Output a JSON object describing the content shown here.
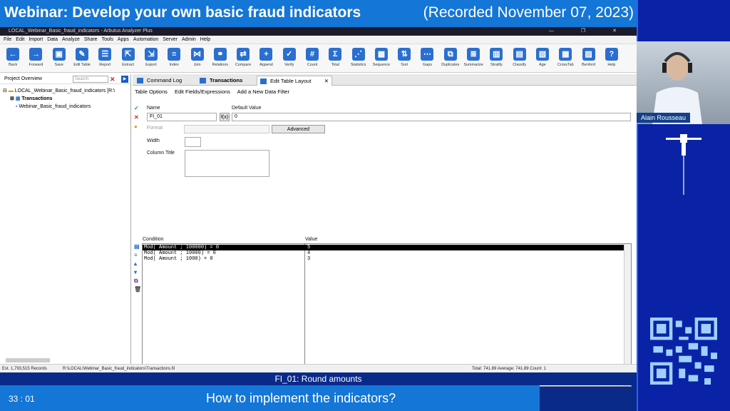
{
  "banner": {
    "title": "Webinar: Develop your own basic fraud indicators",
    "recorded": "(Recorded November 07, 2023)"
  },
  "presenter": {
    "name": "Alain Rousseau"
  },
  "window": {
    "title": "LOCAL_Webinar_Basic_fraud_indicators - Arbutus Analyzer Plus",
    "controls": "— ❐ ✕"
  },
  "menu": [
    "File",
    "Edit",
    "Import",
    "Data",
    "Analyze",
    "Share",
    "Tools",
    "Apps",
    "Automation",
    "Server",
    "Admin",
    "Help"
  ],
  "toolbar": [
    {
      "label": "Back",
      "icon": "back-arrow-icon",
      "glyph": "←"
    },
    {
      "label": "Forward",
      "icon": "forward-arrow-icon",
      "glyph": "→"
    },
    {
      "label": "Save",
      "icon": "save-icon",
      "glyph": "▣"
    },
    {
      "label": "Edit Table",
      "icon": "edit-table-icon",
      "glyph": "✎"
    },
    {
      "label": "Report",
      "icon": "report-icon",
      "glyph": "☰"
    },
    {
      "label": "Extract",
      "icon": "extract-icon",
      "glyph": "⇱"
    },
    {
      "label": "Export",
      "icon": "export-icon",
      "glyph": "⇲"
    },
    {
      "label": "Index",
      "icon": "index-icon",
      "glyph": "≡"
    },
    {
      "label": "Join",
      "icon": "join-icon",
      "glyph": "⋈"
    },
    {
      "label": "Relations",
      "icon": "relations-icon",
      "glyph": "⚭"
    },
    {
      "label": "Compare",
      "icon": "compare-icon",
      "glyph": "⇄"
    },
    {
      "label": "Append",
      "icon": "append-icon",
      "glyph": "+"
    },
    {
      "label": "Verify",
      "icon": "verify-icon",
      "glyph": "✓"
    },
    {
      "label": "Count",
      "icon": "count-icon",
      "glyph": "#"
    },
    {
      "label": "Total",
      "icon": "total-icon",
      "glyph": "Σ"
    },
    {
      "label": "Statistics",
      "icon": "statistics-icon",
      "glyph": "⋰"
    },
    {
      "label": "Sequence",
      "icon": "sequence-icon",
      "glyph": "▦"
    },
    {
      "label": "Sort",
      "icon": "sort-icon",
      "glyph": "⇅"
    },
    {
      "label": "Gaps",
      "icon": "gaps-icon",
      "glyph": "⋯"
    },
    {
      "label": "Duplicates",
      "icon": "duplicates-icon",
      "glyph": "⧉"
    },
    {
      "label": "Summarize",
      "icon": "summarize-icon",
      "glyph": "≣"
    },
    {
      "label": "Stratify",
      "icon": "stratify-icon",
      "glyph": "▥"
    },
    {
      "label": "Classify",
      "icon": "classify-icon",
      "glyph": "▤"
    },
    {
      "label": "Age",
      "icon": "age-icon",
      "glyph": "▧"
    },
    {
      "label": "CrossTab",
      "icon": "crosstab-icon",
      "glyph": "▦"
    },
    {
      "label": "Benford",
      "icon": "benford-icon",
      "glyph": "▨"
    },
    {
      "label": "Help",
      "icon": "help-icon",
      "glyph": "?"
    }
  ],
  "sidebar": {
    "title": "Project Overview",
    "search_placeholder": "Search",
    "tree": [
      "LOCAL_Webinar_Basic_fraud_indicators [R:\\",
      "Transactions",
      "Webinar_Basic_fraud_indicators"
    ]
  },
  "tabs": [
    "Command Log",
    "Transactions",
    "Edit Table Layout"
  ],
  "editor": {
    "subtabs": [
      "Table Options",
      "Edit Fields/Expressions",
      "Add a New Data Filter"
    ],
    "name_label": "Name",
    "name_value": "FI_01",
    "fx_label": "f(x)",
    "default_label": "Default Value",
    "default_value": "0",
    "format_label": "Format",
    "advanced_label": "Advanced",
    "width_label": "Width",
    "column_title_label": "Column Title",
    "condition_header": "Condition",
    "value_header": "Value",
    "rows": [
      {
        "condition": "Mod( Amount ; 100000) = 0",
        "value": "5"
      },
      {
        "condition": "Mod( Amount ; 10000) = 0",
        "value": "4"
      },
      {
        "condition": "Mod( Amount ; 1000) = 0",
        "value": "3"
      }
    ]
  },
  "status": {
    "records": "Est. 1,793,515 Records",
    "path": "R:\\LOCAL\\Webinar_Basic_fraud_indicators\\Transactions.fil",
    "totals": "Total: 741.89  Average: 741.89  Count: 1"
  },
  "caption": {
    "subtitle": "FI_01: Round amounts",
    "time": "33 : 01",
    "question": "How to implement the indicators?"
  },
  "colors": {
    "banner": "#1476d6",
    "navy": "#0a2a8a",
    "accent": "#2a6fd0"
  }
}
